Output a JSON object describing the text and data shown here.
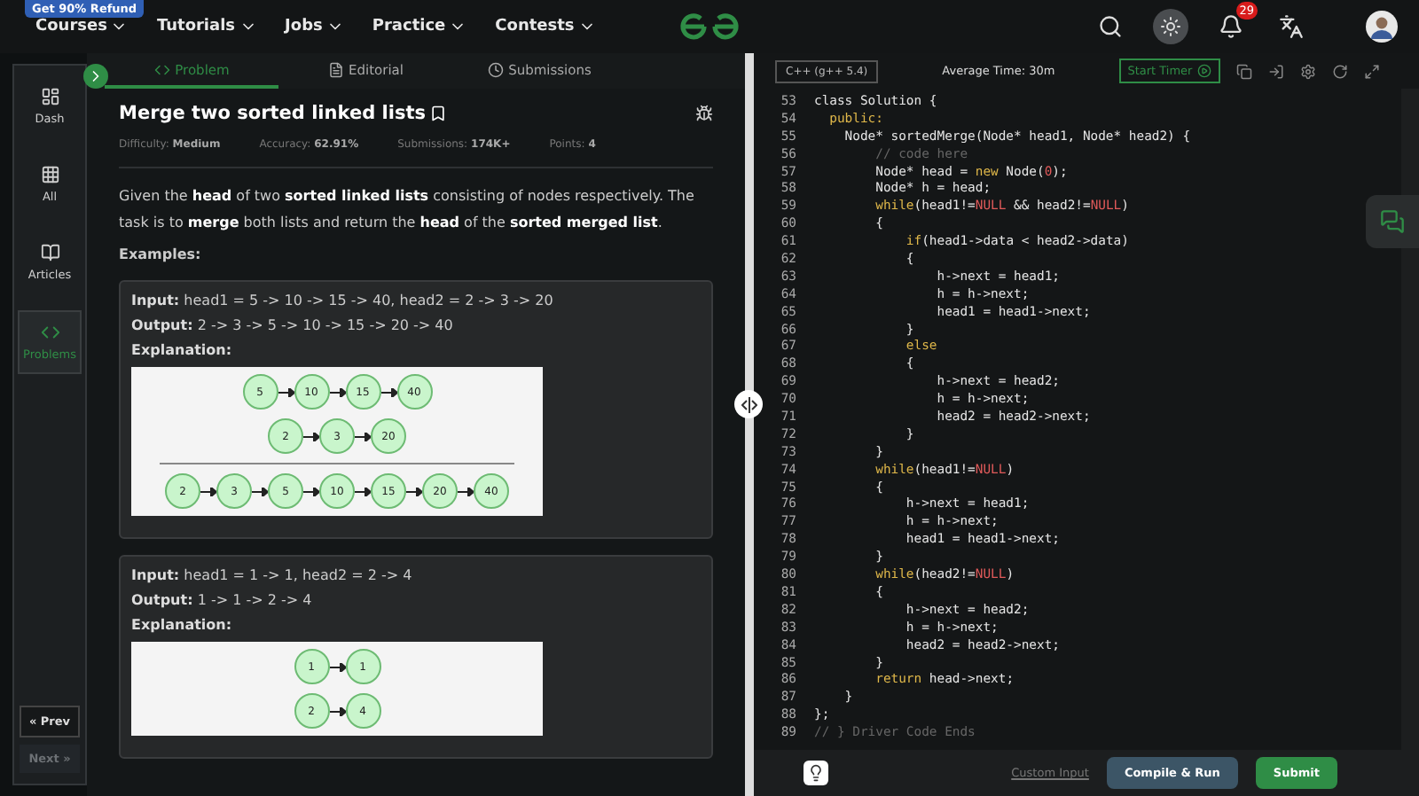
{
  "nav": {
    "promo": "Get 90% Refund",
    "menus": [
      "Courses",
      "Tutorials",
      "Jobs",
      "Practice",
      "Contests"
    ],
    "notifications": "29"
  },
  "sidebar": {
    "items": [
      {
        "label": "Dash",
        "selected": false
      },
      {
        "label": "All",
        "selected": false
      },
      {
        "label": "Articles",
        "selected": false
      },
      {
        "label": "Problems",
        "selected": true
      }
    ],
    "prev": {
      "label": "« Prev",
      "disabled": false
    },
    "next": {
      "label": "Next »",
      "disabled": true
    }
  },
  "tabs": [
    {
      "label": "Problem",
      "selected": true
    },
    {
      "label": "Editorial",
      "selected": false
    },
    {
      "label": "Submissions",
      "selected": false
    }
  ],
  "problem": {
    "title": "Merge two sorted linked lists",
    "meta": [
      {
        "label": "Difficulty:",
        "value": "Medium"
      },
      {
        "label": "Accuracy:",
        "value": "62.91%"
      },
      {
        "label": "Submissions:",
        "value": "174K+"
      },
      {
        "label": "Points:",
        "value": "4"
      }
    ],
    "description": "Given the **head** of two **sorted linked lists** consisting of nodes respectively. The task is to **merge** both lists and return the **head** of the **sorted merged list**.",
    "examples_heading": "Examples:",
    "examples": [
      {
        "input_label": "Input:",
        "input": "head1 = 5 -> 10 -> 15 -> 40, head2 = 2 -> 3 -> 20",
        "output_label": "Output:",
        "output": "2 -> 3 -> 5 -> 10 -> 15 -> 20 -> 40",
        "explanation_label": "Explanation:",
        "diagram": [
          {
            "kind": "list",
            "nodes": [
              "5",
              "10",
              "15",
              "40"
            ]
          },
          {
            "kind": "list",
            "nodes": [
              "2",
              "3",
              "20"
            ]
          },
          {
            "kind": "rule"
          },
          {
            "kind": "list",
            "nodes": [
              "2",
              "3",
              "5",
              "10",
              "15",
              "20",
              "40"
            ]
          }
        ]
      },
      {
        "input_label": "Input:",
        "input": "head1 = 1 -> 1, head2 = 2 -> 4",
        "output_label": "Output:",
        "output": "1 -> 1 -> 2 -> 4",
        "explanation_label": "Explanation:",
        "diagram": [
          {
            "kind": "list",
            "nodes": [
              "1",
              "1"
            ]
          },
          {
            "kind": "list",
            "nodes": [
              "2",
              "4"
            ]
          }
        ]
      }
    ]
  },
  "editor": {
    "language": "C++ (g++ 5.4)",
    "average_time": "Average Time: 30m",
    "timer": "Start Timer",
    "lines": [
      {
        "n": "53",
        "tokens": [
          {
            "kind": "plain",
            "text": "class Solution {"
          }
        ]
      },
      {
        "n": "54",
        "tokens": [
          {
            "kind": "keyword",
            "text": "  public:"
          }
        ]
      },
      {
        "n": "55",
        "tokens": [
          {
            "kind": "plain",
            "text": "    Node* sortedMerge(Node* head1, Node* head2) {"
          }
        ]
      },
      {
        "n": "56",
        "tokens": [
          {
            "kind": "comment",
            "text": "        // code here"
          }
        ]
      },
      {
        "n": "57",
        "tokens": [
          {
            "kind": "plain",
            "text": "        Node* head = "
          },
          {
            "kind": "keyword",
            "text": "new"
          },
          {
            "kind": "plain",
            "text": " Node("
          },
          {
            "kind": "constant",
            "text": "0"
          },
          {
            "kind": "plain",
            "text": ");"
          }
        ]
      },
      {
        "n": "58",
        "tokens": [
          {
            "kind": "plain",
            "text": "        Node* h = head;"
          }
        ]
      },
      {
        "n": "59",
        "tokens": [
          {
            "kind": "keyword",
            "text": "        while"
          },
          {
            "kind": "plain",
            "text": "(head1!="
          },
          {
            "kind": "constant",
            "text": "NULL"
          },
          {
            "kind": "plain",
            "text": " && head2!="
          },
          {
            "kind": "constant",
            "text": "NULL"
          },
          {
            "kind": "plain",
            "text": ")"
          }
        ]
      },
      {
        "n": "60",
        "tokens": [
          {
            "kind": "plain",
            "text": "        {"
          }
        ]
      },
      {
        "n": "61",
        "tokens": [
          {
            "kind": "keyword",
            "text": "            if"
          },
          {
            "kind": "plain",
            "text": "(head1->data < head2->data)"
          }
        ]
      },
      {
        "n": "62",
        "tokens": [
          {
            "kind": "plain",
            "text": "            {"
          }
        ]
      },
      {
        "n": "63",
        "tokens": [
          {
            "kind": "plain",
            "text": "                h->next = head1;"
          }
        ]
      },
      {
        "n": "64",
        "tokens": [
          {
            "kind": "plain",
            "text": "                h = h->next;"
          }
        ]
      },
      {
        "n": "65",
        "tokens": [
          {
            "kind": "plain",
            "text": "                head1 = head1->next;"
          }
        ]
      },
      {
        "n": "66",
        "tokens": [
          {
            "kind": "plain",
            "text": "            }"
          }
        ]
      },
      {
        "n": "67",
        "tokens": [
          {
            "kind": "keyword",
            "text": "            else"
          }
        ]
      },
      {
        "n": "68",
        "tokens": [
          {
            "kind": "plain",
            "text": "            {"
          }
        ]
      },
      {
        "n": "69",
        "tokens": [
          {
            "kind": "plain",
            "text": "                h->next = head2;"
          }
        ]
      },
      {
        "n": "70",
        "tokens": [
          {
            "kind": "plain",
            "text": "                h = h->next;"
          }
        ]
      },
      {
        "n": "71",
        "tokens": [
          {
            "kind": "plain",
            "text": "                head2 = head2->next;"
          }
        ]
      },
      {
        "n": "72",
        "tokens": [
          {
            "kind": "plain",
            "text": "            }"
          }
        ]
      },
      {
        "n": "73",
        "tokens": [
          {
            "kind": "plain",
            "text": "        }"
          }
        ]
      },
      {
        "n": "74",
        "tokens": [
          {
            "kind": "keyword",
            "text": "        while"
          },
          {
            "kind": "plain",
            "text": "(head1!="
          },
          {
            "kind": "constant",
            "text": "NULL"
          },
          {
            "kind": "plain",
            "text": ")"
          }
        ]
      },
      {
        "n": "75",
        "tokens": [
          {
            "kind": "plain",
            "text": "        {"
          }
        ]
      },
      {
        "n": "76",
        "tokens": [
          {
            "kind": "plain",
            "text": "            h->next = head1;"
          }
        ]
      },
      {
        "n": "77",
        "tokens": [
          {
            "kind": "plain",
            "text": "            h = h->next;"
          }
        ]
      },
      {
        "n": "78",
        "tokens": [
          {
            "kind": "plain",
            "text": "            head1 = head1->next;"
          }
        ]
      },
      {
        "n": "79",
        "tokens": [
          {
            "kind": "plain",
            "text": "        }"
          }
        ]
      },
      {
        "n": "80",
        "tokens": [
          {
            "kind": "keyword",
            "text": "        while"
          },
          {
            "kind": "plain",
            "text": "(head2!="
          },
          {
            "kind": "constant",
            "text": "NULL"
          },
          {
            "kind": "plain",
            "text": ")"
          }
        ]
      },
      {
        "n": "81",
        "tokens": [
          {
            "kind": "plain",
            "text": "        {"
          }
        ]
      },
      {
        "n": "82",
        "tokens": [
          {
            "kind": "plain",
            "text": "            h->next = head2;"
          }
        ]
      },
      {
        "n": "83",
        "tokens": [
          {
            "kind": "plain",
            "text": "            h = h->next;"
          }
        ]
      },
      {
        "n": "84",
        "tokens": [
          {
            "kind": "plain",
            "text": "            head2 = head2->next;"
          }
        ]
      },
      {
        "n": "85",
        "tokens": [
          {
            "kind": "plain",
            "text": "        }"
          }
        ]
      },
      {
        "n": "86",
        "tokens": [
          {
            "kind": "keyword",
            "text": "        return"
          },
          {
            "kind": "plain",
            "text": " head->next;"
          }
        ]
      },
      {
        "n": "87",
        "tokens": [
          {
            "kind": "plain",
            "text": "    }"
          }
        ]
      },
      {
        "n": "88",
        "tokens": [
          {
            "kind": "plain",
            "text": "};"
          }
        ]
      },
      {
        "n": "89",
        "tokens": [
          {
            "kind": "comment",
            "text": "// } Driver Code Ends"
          }
        ]
      }
    ],
    "custom_input": "Custom Input",
    "compile": "Compile & Run",
    "submit": "Submit"
  }
}
